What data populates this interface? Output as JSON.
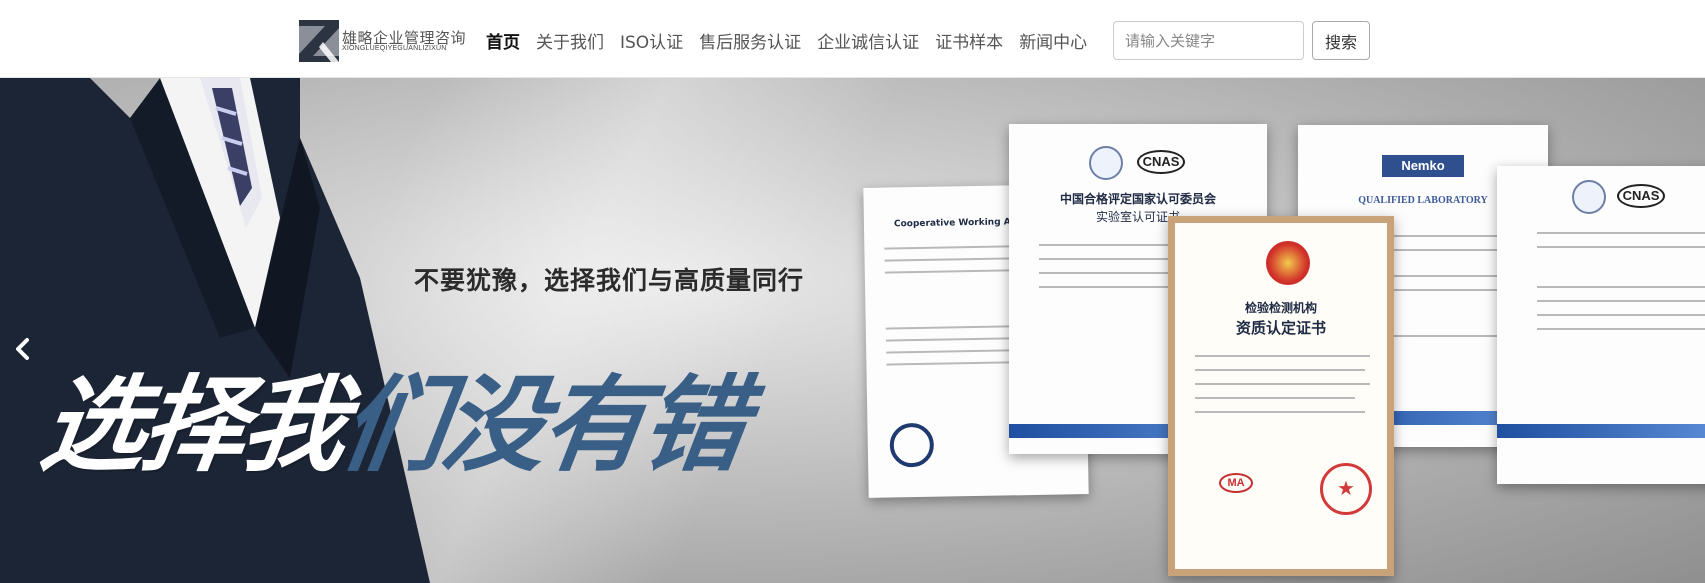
{
  "header": {
    "logo_title": "雄略企业管理咨询",
    "logo_subtitle": "XIONGLUEQIYEGUANLIZIXUN",
    "nav_items": [
      {
        "label": "首页",
        "active": true
      },
      {
        "label": "关于我们",
        "active": false
      },
      {
        "label": "ISO认证",
        "active": false
      },
      {
        "label": "售后服务认证",
        "active": false
      },
      {
        "label": "企业诚信认证",
        "active": false
      },
      {
        "label": "证书样本",
        "active": false
      },
      {
        "label": "新闻中心",
        "active": false
      }
    ],
    "search": {
      "placeholder": "请输入关键字",
      "value": "",
      "button_label": "搜索"
    }
  },
  "banner": {
    "slogan": "不要犹豫，选择我们与高质量同行",
    "headline_part1": "选择我",
    "headline_part2": "们没有错",
    "prev_icon": "chevron-left-icon",
    "certificates": {
      "cert_a_title": "Cooperative Working Arra",
      "cert_b_title": "中国合格评定国家认可委员会",
      "cert_b_subtitle": "实验室认可证书",
      "cert_c_title": "QUALIFIED LABORATORY",
      "cert_c_logo": "Nemko",
      "cert_d_title": "CNAS",
      "cert_e_title": "检验检测机构",
      "cert_e_subtitle": "资质认定证书",
      "cert_e_mark": "MA",
      "cnas_label": "CNAS"
    }
  },
  "colors": {
    "accent_dark": "#1f2a44",
    "headline_blue": "#3a5f86",
    "suit_navy": "#1c2535",
    "seal_red": "#d23a3a"
  }
}
